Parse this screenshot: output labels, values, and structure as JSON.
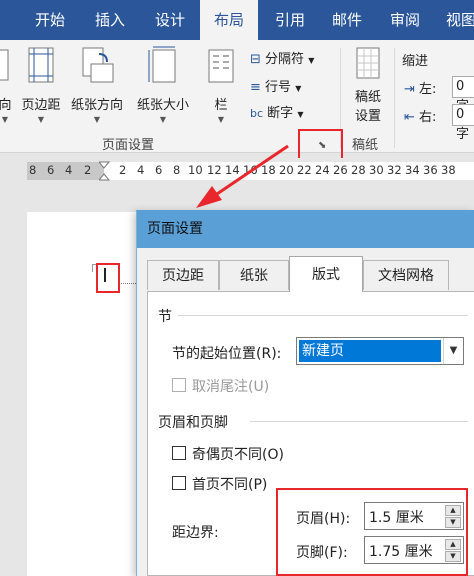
{
  "ribbon_tabs": [
    "开始",
    "插入",
    "设计",
    "布局",
    "引用",
    "邮件",
    "审阅",
    "视图"
  ],
  "active_tab": "布局",
  "ribbon": {
    "direction_partial": "向",
    "margins": "页边距",
    "orientation": "纸张方向",
    "size": "纸张大小",
    "columns": "栏",
    "breaks": "分隔符",
    "line_numbers": "行号",
    "hyphenation": "断字",
    "page_setup_group": "页面设置",
    "manuscript_line1": "稿纸",
    "manuscript_line2": "设置",
    "manuscript_group": "稿纸",
    "indent_title": "缩进",
    "indent_left_label": "左:",
    "indent_right_label": "右:",
    "indent_left_value": "0 字",
    "indent_right_value": "0 字"
  },
  "ruler_numbers": [
    "8",
    "6",
    "4",
    "2",
    "2",
    "4",
    "6",
    "8",
    "10",
    "12",
    "14",
    "16",
    "18",
    "20",
    "22",
    "24",
    "26",
    "28",
    "30",
    "32",
    "34",
    "36",
    "38"
  ],
  "dialog": {
    "title": "页面设置",
    "tabs": [
      "页边距",
      "纸张",
      "版式",
      "文档网格"
    ],
    "active_tab": "版式",
    "section_header": "节",
    "section_start_label": "节的起始位置(R):",
    "section_start_value": "新建页",
    "suppress_endnotes": "取消尾注(U)",
    "header_footer_header": "页眉和页脚",
    "odd_even": "奇偶页不同(O)",
    "first_page": "首页不同(P)",
    "from_edge": "距边界:",
    "header_label": "页眉(H):",
    "header_value": "1.5 厘米",
    "footer_label": "页脚(F):",
    "footer_value": "1.75 厘米"
  },
  "colors": {
    "title_bar": "#2b579a",
    "dialog_title": "#5aa0d6",
    "selection": "#0078d7",
    "highlight_red": "#e8262c"
  }
}
